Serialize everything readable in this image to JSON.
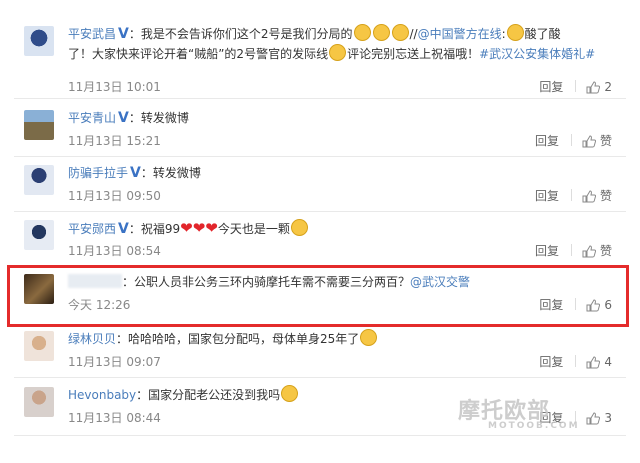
{
  "comments": [
    {
      "user": "平安武昌",
      "verified": "V",
      "parts": [
        {
          "t": "text",
          "v": "：我是不会告诉你们这个2号是我们分局的"
        },
        {
          "t": "emoji"
        },
        {
          "t": "emoji"
        },
        {
          "t": "emoji"
        },
        {
          "t": "text",
          "v": "//"
        },
        {
          "t": "link",
          "v": "@中国警方在线"
        },
        {
          "t": "text",
          "v": ":"
        },
        {
          "t": "emoji"
        },
        {
          "t": "text",
          "v": "酸了酸"
        }
      ],
      "line2": [
        {
          "t": "text",
          "v": "了！大家快来评论开着“贼船”的2号警官的发际线"
        },
        {
          "t": "emoji"
        },
        {
          "t": "text",
          "v": "评论完别忘送上祝福哦！"
        },
        {
          "t": "link",
          "v": "#武汉公安集体婚礼#"
        }
      ],
      "time": "11月13日 10:01",
      "reply": "回复",
      "likes": "2"
    },
    {
      "user": "平安青山",
      "verified": "V",
      "parts": [
        {
          "t": "text",
          "v": "：转发微博"
        }
      ],
      "time": "11月13日 15:21",
      "reply": "回复",
      "likes": "赞"
    },
    {
      "user": "防骗手拉手",
      "verified": "V",
      "parts": [
        {
          "t": "text",
          "v": "：转发微博"
        }
      ],
      "time": "11月13日 09:50",
      "reply": "回复",
      "likes": "赞"
    },
    {
      "user": "平安郧西",
      "verified": "V",
      "parts": [
        {
          "t": "text",
          "v": "：祝福99"
        },
        {
          "t": "heart"
        },
        {
          "t": "heart"
        },
        {
          "t": "heart"
        },
        {
          "t": "text",
          "v": "今天也是一颗"
        },
        {
          "t": "emoji"
        }
      ],
      "time": "11月13日 08:54",
      "reply": "回复",
      "likes": "赞"
    },
    {
      "user": "",
      "verified": "",
      "parts": [
        {
          "t": "text",
          "v": "：公职人员非公务三环内骑摩托车需不需要三分两百？"
        },
        {
          "t": "link",
          "v": "@武汉交警"
        }
      ],
      "time": "今天 12:26",
      "reply": "回复",
      "likes": "6"
    },
    {
      "user": "绿林贝贝",
      "verified": "",
      "parts": [
        {
          "t": "text",
          "v": "：哈哈哈哈，国家包分配吗，母体单身25年了"
        },
        {
          "t": "emoji"
        }
      ],
      "time": "11月13日 09:07",
      "reply": "回复",
      "likes": "4"
    },
    {
      "user": "Hevonbaby",
      "verified": "",
      "parts": [
        {
          "t": "text",
          "v": "：国家分配老公还没到我吗"
        },
        {
          "t": "emoji"
        }
      ],
      "time": "11月13日 08:44",
      "reply": "回复",
      "likes": "3"
    }
  ],
  "watermark": {
    "main": "摩托欧部",
    "sub": "MOTOOB.COM"
  },
  "colors": {
    "link": "#4a7dbb",
    "highlight": "#e42b2b",
    "heart": "#e2252b"
  }
}
